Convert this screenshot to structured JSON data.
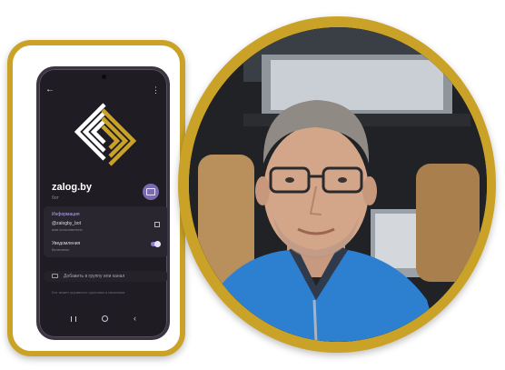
{
  "phone": {
    "name": "zalog.by",
    "subtitle": "бот",
    "info_title": "Информация",
    "username": "@zalogby_bot",
    "username_caption": "имя пользователя",
    "notifications_title": "Уведомления",
    "notifications_state": "Включены",
    "add_group": "Добавить в группу или канал",
    "note": "Бот может управлять группами и каналами."
  },
  "colors": {
    "gold": "#c9a227",
    "phone_bg": "#1f1c24",
    "accent": "#8d7fd0",
    "jacket": "#2d7fd0"
  },
  "icons": [
    "back-arrow-icon",
    "more-vertical-icon",
    "message-icon",
    "qr-code-icon",
    "toggle-switch",
    "add-group-icon",
    "recent-apps-icon",
    "home-icon",
    "nav-back-icon"
  ]
}
